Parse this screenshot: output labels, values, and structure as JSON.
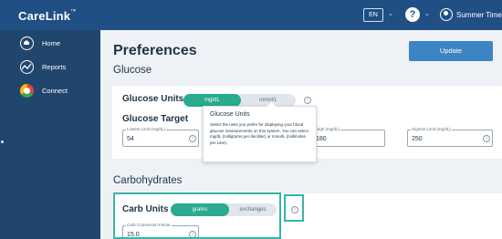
{
  "app": {
    "name": "CareLink",
    "trademark": "™"
  },
  "topbar": {
    "language": "EN",
    "help_icon": "help-circle-icon",
    "user_icon": "user-circle-icon",
    "user_name": "Summer Time",
    "caret": "⌄"
  },
  "sidebar": {
    "items": [
      {
        "label": "Home",
        "icon": "home-icon"
      },
      {
        "label": "Reports",
        "icon": "reports-icon"
      },
      {
        "label": "Connect",
        "icon": "connect-icon"
      }
    ]
  },
  "page": {
    "title": "Preferences",
    "update_label": "Update"
  },
  "glucose": {
    "section_title": "Glucose",
    "units_label": "Glucose Units",
    "unit_options": [
      "mg/dL",
      "mmol/L"
    ],
    "selected_unit": "mg/dL",
    "target_label": "Glucose Target",
    "lowest_label": "Lowest Limit (mg/dL)",
    "lowest_value": "54",
    "high_label": "High (mg/dL)",
    "high_value": "180",
    "highest_label": "Highest Limit (mg/dL)",
    "highest_value": "250"
  },
  "tooltip": {
    "title": "Glucose Units",
    "body": "Select the units you prefer for displaying your blood glucose measurements on this system. You can select mg/dL (milligrams per deciliter) or mmol/L (millimoles per Liter)."
  },
  "carbs": {
    "section_title": "Carbohydrates",
    "units_label": "Carb Units",
    "unit_options": [
      "grams",
      "exchanges"
    ],
    "selected_unit": "grams",
    "factor_label": "Carb Conversion Factor",
    "factor_value": "15.0"
  },
  "colors": {
    "topbar": "#1f4f83",
    "sidebar": "#21466e",
    "accent": "#2aaa8e",
    "button": "#3d84c4",
    "highlight": "#35b5a5"
  }
}
